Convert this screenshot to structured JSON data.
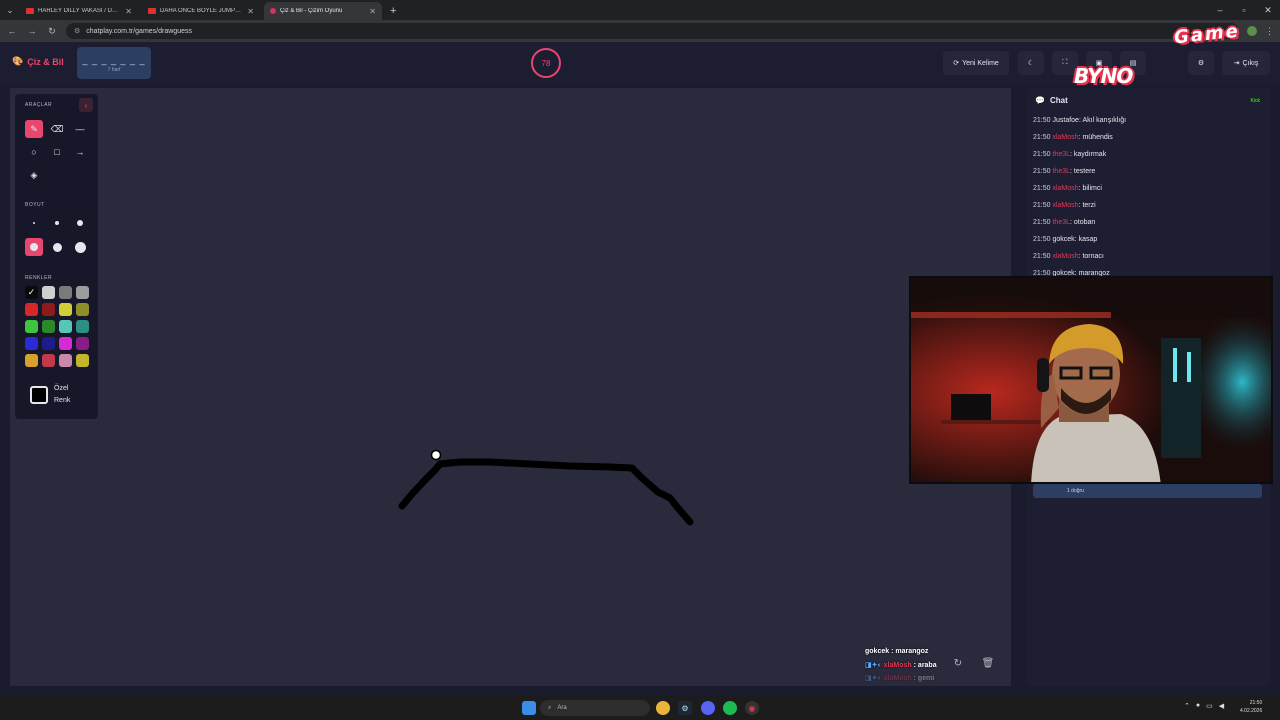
{
  "browser": {
    "tabs": [
      {
        "label": "HARLEY DILLY VAKASI / DEDEY",
        "active": false,
        "icon": "youtube-icon"
      },
      {
        "label": "DAHA ÖNCE BÖYLE JUMPSCAR",
        "active": false,
        "icon": "youtube-icon"
      },
      {
        "label": "Çiz & Bil - Çizim Oyunu",
        "active": true,
        "icon": "palette-icon"
      }
    ],
    "url": "chatplay.com.tr/games/drawguess"
  },
  "header": {
    "brand": "Çiz & Bil",
    "word_blanks": "_ _ _ _ _ _ _",
    "word_hint": "7 harf",
    "timer": "78",
    "new_word_label": "Yeni Kelime",
    "exit_label": "Çıkış"
  },
  "watermark": {
    "part1": "BYNO",
    "part2": "Game"
  },
  "toolbox": {
    "tools_title": "ARAÇLAR",
    "size_title": "BOYUT",
    "colors_title": "RENKLER",
    "custom_color_label": "Özel Renk",
    "colors": [
      "#0a0a0a",
      "#cfcfcf",
      "#7a7a7a",
      "#9c9c9c",
      "#d62828",
      "#8c1c1c",
      "#cfcf3a",
      "#8f8f2a",
      "#3ec43e",
      "#2a8a2a",
      "#55c6b8",
      "#2c8f84",
      "#2a2ad6",
      "#1c1c8a",
      "#d62ad6",
      "#8a1c8a",
      "#d6a22a",
      "#c23a4a",
      "#c88aa8",
      "#c2b52a"
    ]
  },
  "chat": {
    "title": "Chat",
    "platform": "Kick",
    "messages": [
      {
        "time": "21:50",
        "user": "Justafoe",
        "text": "Akıl karışıklığı",
        "red": false
      },
      {
        "time": "21:50",
        "user": "xlaMosh",
        "text": "mühendis",
        "red": true
      },
      {
        "time": "21:50",
        "user": "the3L",
        "text": "kaydırmak",
        "red": true
      },
      {
        "time": "21:50",
        "user": "the3L",
        "text": "testere",
        "red": true
      },
      {
        "time": "21:50",
        "user": "xlaMosh",
        "text": "bilimci",
        "red": true
      },
      {
        "time": "21:50",
        "user": "xlaMosh",
        "text": "terzi",
        "red": true
      },
      {
        "time": "21:50",
        "user": "the3L",
        "text": "otoban",
        "red": true
      },
      {
        "time": "21:50",
        "user": "gokcek",
        "text": "kasap",
        "red": false
      },
      {
        "time": "21:50",
        "user": "xlaMosh",
        "text": "tornacı",
        "red": true
      },
      {
        "time": "21:50",
        "user": "gokcek",
        "text": "marangoz",
        "red": false
      }
    ],
    "guess_status": "1 doğru"
  },
  "overlay_chat": [
    {
      "user": "gokcek",
      "text": "marangoz",
      "red": false
    },
    {
      "user": "xlaMosh",
      "text": "araba",
      "red": true
    },
    {
      "user": "xlaMosh",
      "text": "gemi",
      "red": true
    }
  ],
  "taskbar": {
    "search_placeholder": "Ara",
    "time": "21:50",
    "date": "4.02.2026"
  }
}
